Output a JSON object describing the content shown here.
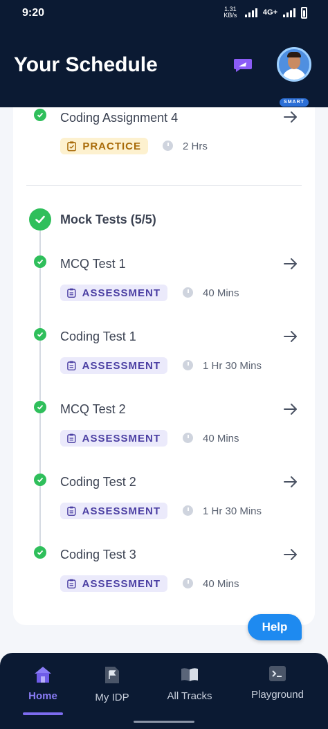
{
  "status_bar": {
    "time": "9:20",
    "network": "4G+",
    "speed": "1.31 KB/s"
  },
  "header": {
    "title": "Your Schedule",
    "avatar_badge": "SMART"
  },
  "top_item": {
    "title": "Coding Assignment 4",
    "tag": "PRACTICE",
    "duration": "2 Hrs"
  },
  "section": {
    "title": "Mock Tests (5/5)",
    "items": [
      {
        "title": "MCQ Test 1",
        "tag": "ASSESSMENT",
        "duration": "40 Mins"
      },
      {
        "title": "Coding Test 1",
        "tag": "ASSESSMENT",
        "duration": "1 Hr 30 Mins"
      },
      {
        "title": "MCQ Test 2",
        "tag": "ASSESSMENT",
        "duration": "40 Mins"
      },
      {
        "title": "Coding Test 2",
        "tag": "ASSESSMENT",
        "duration": "1 Hr 30 Mins"
      },
      {
        "title": "Coding Test 3",
        "tag": "ASSESSMENT",
        "duration": "40 Mins"
      }
    ]
  },
  "help_button": "Help",
  "bottom_nav": {
    "items": [
      {
        "label": "Home",
        "icon": "home-icon",
        "active": true
      },
      {
        "label": "My IDP",
        "icon": "flag-document-icon",
        "active": false
      },
      {
        "label": "All Tracks",
        "icon": "book-icon",
        "active": false
      },
      {
        "label": "Playground",
        "icon": "terminal-icon",
        "active": false
      }
    ]
  },
  "colors": {
    "header_bg": "#0b1a33",
    "check_green": "#2fbf5b",
    "practice_text": "#a86a08",
    "assessment_text": "#4b3fa3",
    "help_blue": "#1e8af0",
    "nav_active": "#8a7cf6"
  }
}
